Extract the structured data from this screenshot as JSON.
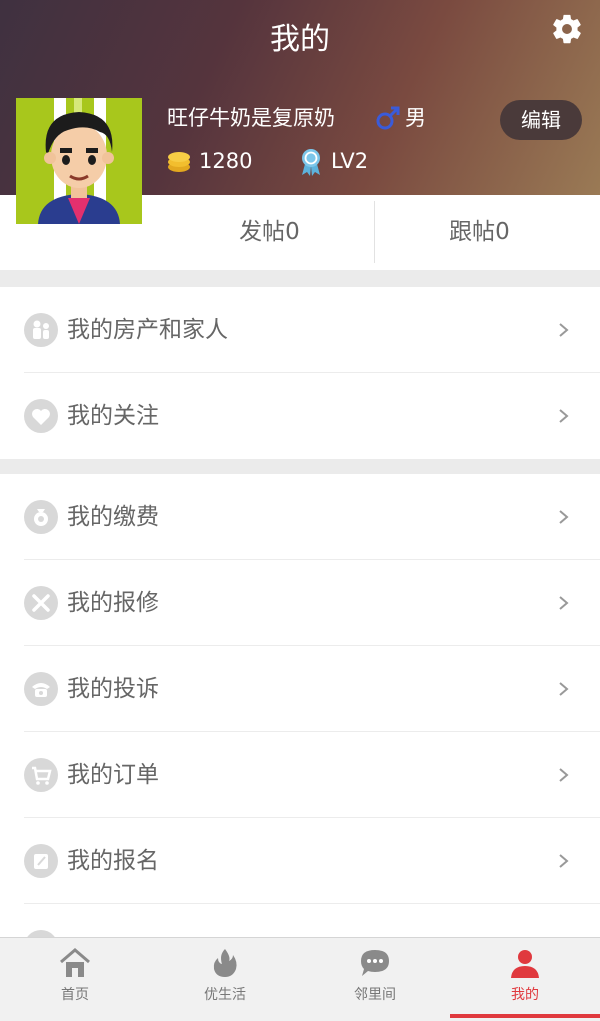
{
  "header": {
    "title": "我的",
    "settings_icon": "gear-icon"
  },
  "profile": {
    "username": "旺仔牛奶是复原奶",
    "gender": "男",
    "coins": "1280",
    "level": "LV2",
    "edit_label": "编辑"
  },
  "stats": {
    "posts": "发帖0",
    "follows": "跟帖0"
  },
  "menu_group1": [
    {
      "label": "我的房产和家人",
      "icon": "family-icon"
    },
    {
      "label": "我的关注",
      "icon": "heart-icon"
    }
  ],
  "menu_group2": [
    {
      "label": "我的缴费",
      "icon": "money-bag-icon"
    },
    {
      "label": "我的报修",
      "icon": "tools-icon"
    },
    {
      "label": "我的投诉",
      "icon": "phone-icon"
    },
    {
      "label": "我的订单",
      "icon": "cart-icon"
    },
    {
      "label": "我的报名",
      "icon": "edit-icon"
    }
  ],
  "tabs": [
    {
      "label": "首页",
      "icon": "home-icon"
    },
    {
      "label": "优生活",
      "icon": "flame-icon"
    },
    {
      "label": "邻里间",
      "icon": "chat-icon"
    },
    {
      "label": "我的",
      "icon": "person-icon"
    }
  ],
  "colors": {
    "accent": "#e0393e",
    "text": "#666666",
    "icon_gray": "#d8d8d8"
  }
}
